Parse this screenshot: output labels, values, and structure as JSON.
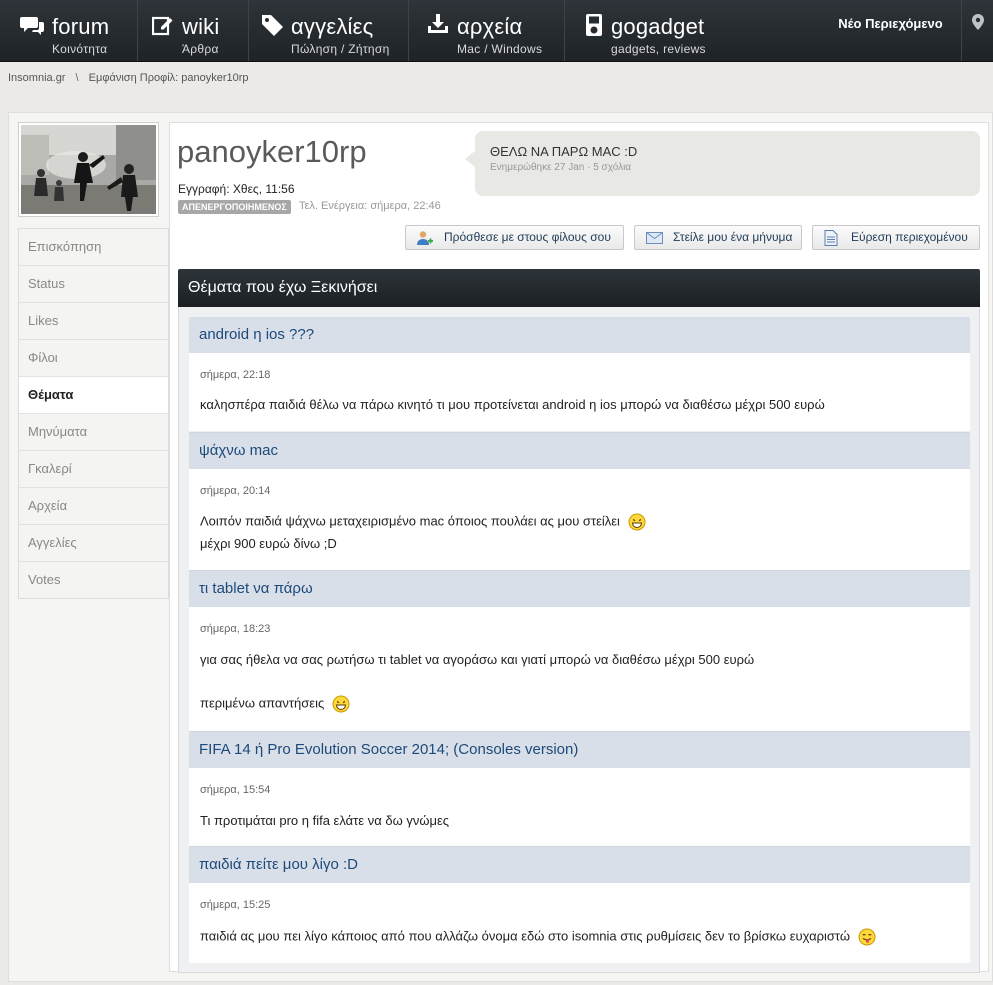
{
  "nav": {
    "items": [
      {
        "title": "forum",
        "subtitle": "Κοινότητα",
        "icon": "chat-icon"
      },
      {
        "title": "wiki",
        "subtitle": "Άρθρα",
        "icon": "edit-icon"
      },
      {
        "title": "αγγελίες",
        "subtitle": "Πώληση / Ζήτηση",
        "icon": "tag-icon"
      },
      {
        "title": "αρχεία",
        "subtitle": "Mac / Windows",
        "icon": "download-icon"
      },
      {
        "title": "gogadget",
        "subtitle": "gadgets, reviews",
        "icon": "ipod-icon"
      }
    ],
    "new_content": "Νέο Περιεχόμενο",
    "pin_icon": "map-pin-icon"
  },
  "breadcrumb": {
    "home": "Insomnia.gr",
    "separator": "\\",
    "current": "Εμφάνιση Προφίλ: panoyker10rp"
  },
  "profile": {
    "username": "panoyker10rp",
    "joined": "Εγγραφή: Χθες, 11:56",
    "badge": "ΑΠΕΝΕΡΓΟΠΟΙΗΜΕΝΟΣ",
    "last_activity": "Τελ. Ενέργεια: σήμερα, 22:46",
    "status": {
      "text": "ΘΕΛΩ ΝΑ ΠΑΡΩ MAC :D",
      "meta": "Ενημερώθηκε 27 Jan · 5 σχόλια"
    }
  },
  "actions": {
    "add_friend": "Πρόσθεσε με στους φίλους σου",
    "send_message": "Στείλε μου ένα μήνυμα",
    "find_content": "Εύρεση περιεχομένου"
  },
  "sidebar": {
    "items": [
      "Επισκόπηση",
      "Status",
      "Likes",
      "Φίλοι",
      "Θέματα",
      "Μηνύματα",
      "Γκαλερί",
      "Αρχεία",
      "Αγγελίες",
      "Votes"
    ],
    "active": "Θέματα"
  },
  "topics": {
    "header": "Θέματα που έχω Ξεκινήσει",
    "items": [
      {
        "title": "android η ios ???",
        "date": "σήμερα, 22:18",
        "lines": [
          "καλησπέρα παιδιά θέλω να πάρω κινητό τι μου προτείνεται android η ios μπορώ να διαθέσω μέχρι 500 ευρώ"
        ]
      },
      {
        "title": "ψάχνω mac",
        "date": "σήμερα, 20:14",
        "lines": [
          "Λοιπόν παιδιά ψάχνω μεταχειρισμένο mac όποιος πουλάει ας μου στείλει",
          "μέχρι 900 ευρώ δίνω ;D"
        ]
      },
      {
        "title": "τι tablet να πάρω",
        "date": "σήμερα, 18:23",
        "lines": [
          "για σας ήθελα να σας ρωτήσω τι tablet να αγοράσω και γιατί μπορώ να διαθέσω μέχρι 500 ευρώ",
          "περιμένω απαντήσεις"
        ]
      },
      {
        "title": "FIFA 14 ή Pro Evolution Soccer 2014; (Consoles version)",
        "date": "σήμερα, 15:54",
        "lines": [
          "Τι προτιμάται pro η fifa ελάτε να δω γνώμες"
        ]
      },
      {
        "title": "παιδιά πείτε μου λίγο :D",
        "date": "σήμερα, 15:25",
        "lines": [
          "παιδιά ας μου πει λίγο κάποιος από που αλλάζω όνομα εδώ στο isomnia στις ρυθμίσεις δεν το βρίσκω ευχαριστώ"
        ]
      }
    ]
  },
  "colors": {
    "nav_bg": "#23282c",
    "topic_title_bg": "#d9dfe8",
    "topic_title_text": "#1c4a7a",
    "badge_bg": "#a7a7a7"
  }
}
